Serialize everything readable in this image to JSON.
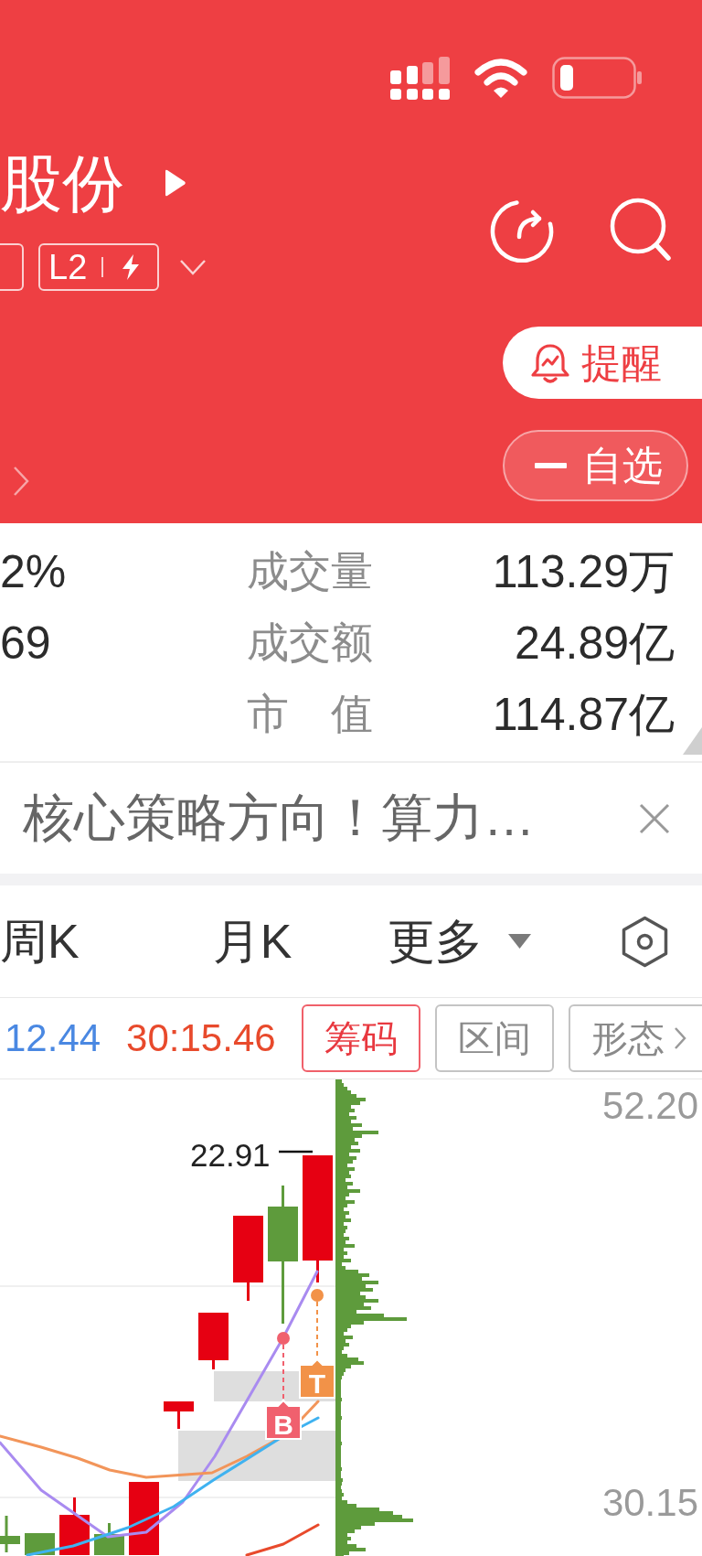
{
  "header": {
    "title": "股份",
    "badge": {
      "label": "L2"
    },
    "actions": [
      {
        "kind": "alert",
        "label": "提醒"
      },
      {
        "kind": "watchlist",
        "label": "自选"
      }
    ]
  },
  "quote_stats": {
    "rows": [
      {
        "column_1": "2%",
        "label": "成交量",
        "value": "113.29万"
      },
      {
        "column_1": "69",
        "label": "成交额",
        "value": "24.89亿"
      },
      {
        "label": "市　值",
        "value": "114.87亿"
      }
    ]
  },
  "news_banner": {
    "text": "核心策略方向！算力…"
  },
  "period_tabs": [
    {
      "label": "周K",
      "kind": "tab",
      "selected": false
    },
    {
      "label": "月K",
      "kind": "tab",
      "selected": false
    },
    {
      "label": "更多",
      "kind": "dropdown",
      "selected": false
    }
  ],
  "chart_toolbar": {
    "readings": [
      {
        "text": "12.44",
        "color": "#4a88e2"
      },
      {
        "text": "30:15.46",
        "color": "#e84a2c"
      }
    ],
    "tools": [
      {
        "label": "筹码",
        "kind": "toggle",
        "selected": true
      },
      {
        "label": "区间",
        "kind": "toggle",
        "selected": false
      },
      {
        "label": "形态",
        "kind": "menu",
        "selected": false
      }
    ]
  },
  "chart": {
    "axis_labels": [
      "52.20",
      "30.15"
    ],
    "high_label": "22.91",
    "signals": [
      {
        "label": "B",
        "color": "#f0606e"
      },
      {
        "label": "T",
        "color": "#f29248"
      }
    ]
  }
}
